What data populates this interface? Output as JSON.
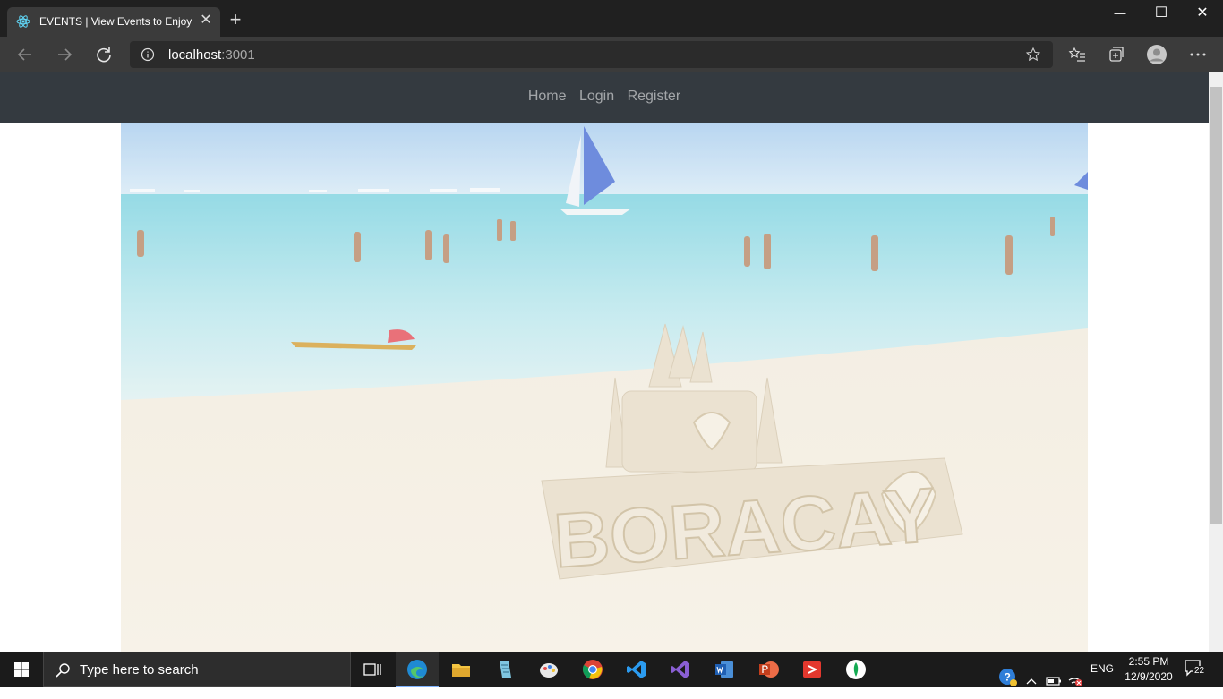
{
  "browser": {
    "tab_title": "EVENTS | View Events to Enjoy",
    "tab_close": "✕",
    "new_tab": "+",
    "url_host": "localhost",
    "url_port": ":3001",
    "window_controls": {
      "minimize": "—",
      "maximize": "☐",
      "close": "✕"
    },
    "icons": [
      "back-icon",
      "forward-icon",
      "refresh-icon",
      "info-icon",
      "star-icon",
      "favorites-icon",
      "collections-icon",
      "profile-icon",
      "more-icon"
    ]
  },
  "site": {
    "nav": [
      {
        "label": "Home"
      },
      {
        "label": "Login"
      },
      {
        "label": "Register"
      }
    ],
    "hero": {
      "sandcastle_text": "BORACAY"
    }
  },
  "taskbar": {
    "search_placeholder": "Type here to search",
    "apps": [
      "task-view",
      "edge",
      "file-explorer",
      "notepad",
      "paint",
      "chrome",
      "vscode",
      "visual-studio",
      "word",
      "powerpoint",
      "git",
      "mongodb"
    ],
    "language": "ENG",
    "time": "2:55 PM",
    "date": "12/9/2020",
    "notification_count": "22"
  }
}
